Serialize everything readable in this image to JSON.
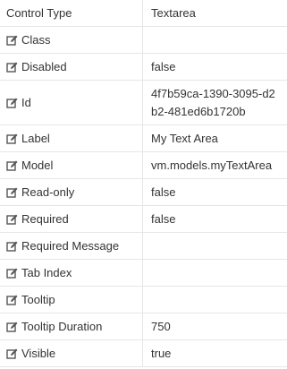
{
  "header": {
    "name": "Control Type",
    "value": "Textarea"
  },
  "properties": [
    {
      "name": "Class",
      "value": ""
    },
    {
      "name": "Disabled",
      "value": "false"
    },
    {
      "name": "Id",
      "value": "4f7b59ca-1390-3095-d2b2-481ed6b1720b"
    },
    {
      "name": "Label",
      "value": "My Text Area"
    },
    {
      "name": "Model",
      "value": "vm.models.myTextArea"
    },
    {
      "name": "Read-only",
      "value": "false"
    },
    {
      "name": "Required",
      "value": "false"
    },
    {
      "name": "Required Message",
      "value": ""
    },
    {
      "name": "Tab Index",
      "value": ""
    },
    {
      "name": "Tooltip",
      "value": ""
    },
    {
      "name": "Tooltip Duration",
      "value": "750"
    },
    {
      "name": "Visible",
      "value": "true"
    }
  ],
  "icon": "edit-icon",
  "colors": {
    "text": "#333333",
    "border": "#e6e6e6",
    "icon": "#555555"
  }
}
